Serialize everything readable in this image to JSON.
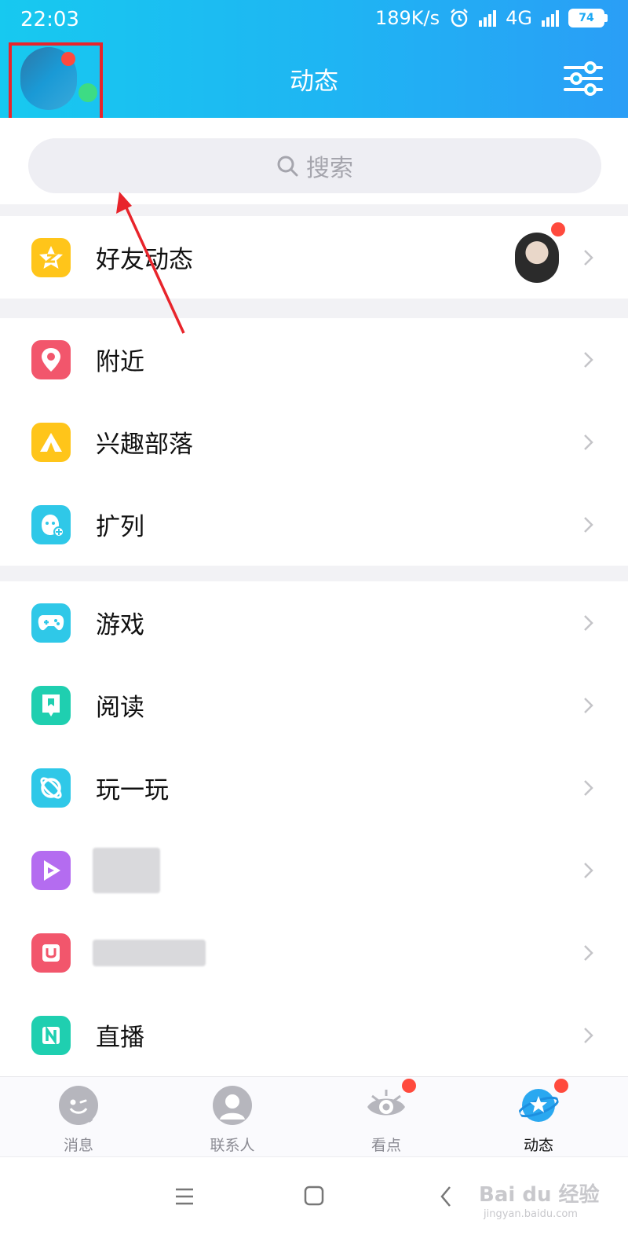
{
  "status": {
    "time": "22:03",
    "network_speed": "189K/s",
    "network_type": "4G",
    "battery": "74"
  },
  "header": {
    "title": "动态",
    "settings_icon": "settings-sliders-icon"
  },
  "search": {
    "placeholder": "搜索"
  },
  "sections": [
    {
      "items": [
        {
          "label": "好友动态",
          "icon": "friends-feed-star-icon",
          "color": "#ffc51a"
        }
      ]
    },
    {
      "items": [
        {
          "label": "附近",
          "icon": "location-pin-icon",
          "color": "#f2566c"
        },
        {
          "label": "兴趣部落",
          "icon": "tent-icon",
          "color": "#ffc51a"
        },
        {
          "label": "扩列",
          "icon": "add-friend-face-icon",
          "color": "#2fc8e8"
        }
      ]
    },
    {
      "items": [
        {
          "label": "游戏",
          "icon": "gamepad-icon",
          "color": "#2fc8e8"
        },
        {
          "label": "阅读",
          "icon": "book-icon",
          "color": "#1fcfb0"
        },
        {
          "label": "玩一玩",
          "icon": "planet-icon",
          "color": "#2fc8e8"
        },
        {
          "label": "",
          "icon": "video-play-icon",
          "color": "#b46cf0"
        },
        {
          "label": "",
          "icon": "u-letter-icon",
          "color": "#f2566c"
        },
        {
          "label": "直播",
          "icon": "live-n-icon",
          "color": "#1fcfb0"
        }
      ]
    }
  ],
  "tabbar": {
    "tabs": [
      {
        "label": "消息",
        "icon": "message-face-icon"
      },
      {
        "label": "联系人",
        "icon": "contact-person-icon"
      },
      {
        "label": "看点",
        "icon": "eye-icon"
      },
      {
        "label": "动态",
        "icon": "planet-star-icon",
        "active": true
      }
    ]
  },
  "watermark": {
    "text": "Bai du 经验",
    "url": "jingyan.baidu.com"
  },
  "colors": {
    "header_start": "#17c9f0",
    "header_end": "#2a9ef6",
    "badge_red": "#ff4a3d",
    "annotation_red": "#e8242b"
  }
}
